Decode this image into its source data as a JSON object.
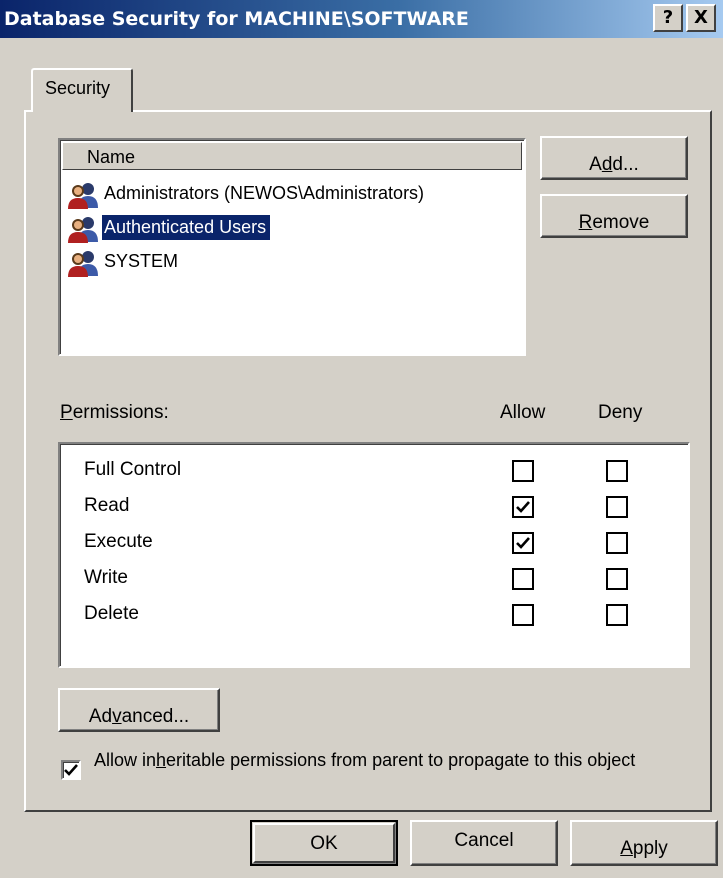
{
  "window": {
    "title": "Database Security for MACHINE\\SOFTWARE",
    "help_label": "?",
    "close_label": "X"
  },
  "tabs": [
    {
      "label": "Security",
      "active": true
    }
  ],
  "names_list": {
    "column_header": "Name",
    "items": [
      {
        "label": "Administrators (NEWOS\\Administrators)",
        "icon": "group-icon",
        "selected": false
      },
      {
        "label": "Authenticated Users",
        "icon": "group-icon",
        "selected": true
      },
      {
        "label": "SYSTEM",
        "icon": "group-icon",
        "selected": false
      }
    ]
  },
  "buttons": {
    "add": {
      "pre": "A",
      "acc": "d",
      "post": "d..."
    },
    "remove": {
      "pre": "",
      "acc": "R",
      "post": "emove"
    },
    "advanced": {
      "pre": "Ad",
      "acc": "v",
      "post": "anced..."
    },
    "ok": "OK",
    "cancel": "Cancel",
    "apply": {
      "pre": "",
      "acc": "A",
      "post": "pply"
    }
  },
  "permissions": {
    "label": {
      "pre": "",
      "acc": "P",
      "post": "ermissions:"
    },
    "allow_header": "Allow",
    "deny_header": "Deny",
    "rows": [
      {
        "name": "Full Control",
        "allow": false,
        "deny": false
      },
      {
        "name": "Read",
        "allow": true,
        "deny": false
      },
      {
        "name": "Execute",
        "allow": true,
        "deny": false
      },
      {
        "name": "Write",
        "allow": false,
        "deny": false
      },
      {
        "name": "Delete",
        "allow": false,
        "deny": false
      }
    ]
  },
  "inherit": {
    "checked": true,
    "pre": "Allow in",
    "acc": "h",
    "post": "eritable permissions from parent to propagate to this object"
  },
  "colors": {
    "selection": "#0a246a",
    "face": "#d4d0c8",
    "title_gradient_start": "#0a246a",
    "title_gradient_end": "#a6caf0"
  }
}
